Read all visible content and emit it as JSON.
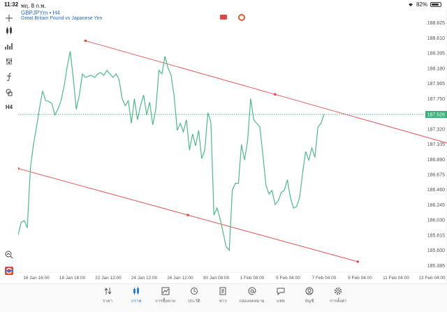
{
  "status": {
    "time": "11:32",
    "date": "พฤ. 8 ก.พ.",
    "battery": "82%",
    "battery_level": 0.82
  },
  "symbol": {
    "title": "GBPJPYm • H4",
    "description": "Great Britain Pound vs Japanese Yen"
  },
  "side_tools": {
    "timeframe": "H4"
  },
  "colors": {
    "line": "#4fb987",
    "trend": "#e24b4b",
    "price_line": "#3bb07a",
    "price_label_bg": "#3bb07a",
    "active_tab": "#2a7be4"
  },
  "chart_data": {
    "type": "line",
    "price_levels": [
      "188.825",
      "188.610",
      "188.395",
      "188.180",
      "187.965",
      "187.750",
      "187.535",
      "187.320",
      "187.105",
      "186.890",
      "186.675",
      "186.460",
      "186.245",
      "186.030",
      "185.815",
      "185.600",
      "185.385"
    ],
    "ylim": [
      185.33,
      188.91
    ],
    "time_labels": [
      "16 Jan 16:00",
      "18 Jan 16:00",
      "22 Jan 12:00",
      "24 Jan 12:00",
      "26 Jan 12:00",
      "30 Jan 08:00",
      "1 Feb 08:00",
      "5 Feb 04:00",
      "7 Feb 04:00",
      "9 Feb 04:00",
      "11 Feb 04:00",
      "13 Feb 04:00"
    ],
    "current_price": "187.526",
    "current_price_value": 187.526,
    "series": [
      {
        "values": [
          185.82,
          186.0,
          186.02,
          185.92,
          186.76,
          187.1,
          187.35,
          187.62,
          187.86,
          187.72,
          187.71,
          187.68,
          187.52,
          187.6,
          187.72,
          187.92,
          188.2,
          188.42,
          188.05,
          187.6,
          187.8,
          188.1,
          188.05,
          188.07,
          188.08,
          188.05,
          188.1,
          188.12,
          188.08,
          188.15,
          188.1,
          188.05,
          188.1,
          188.02,
          187.75,
          187.65,
          187.72,
          187.4,
          187.75,
          187.45,
          187.65,
          187.8,
          187.52,
          187.7,
          187.38,
          187.6,
          188.15,
          188.1,
          188.35,
          188.18,
          188.08,
          187.78,
          187.3,
          187.4,
          187.28,
          187.45,
          187.02,
          187.25,
          187.08,
          187.3,
          186.9,
          187.02,
          187.55,
          187.42,
          186.1,
          186.2,
          186.05,
          185.85,
          185.65,
          185.6,
          186.45,
          186.55,
          186.55,
          187.1,
          186.88,
          187.15,
          187.75,
          187.45,
          187.4,
          187.35,
          186.95,
          186.52,
          186.4,
          186.45,
          186.25,
          186.3,
          186.42,
          186.45,
          186.6,
          186.35,
          186.2,
          186.22,
          186.35,
          186.7,
          187.0,
          186.88,
          187.05,
          186.92,
          187.35,
          187.4,
          187.53
        ]
      }
    ],
    "trendlines": [
      {
        "from": {
          "index": 22,
          "value": 188.57
        },
        "to": {
          "index": 146,
          "value": 187.05
        }
      },
      {
        "from": {
          "index": 0,
          "value": 186.76
        },
        "to": {
          "index": 111,
          "value": 185.44
        }
      }
    ]
  },
  "tabs": [
    {
      "label": "ราคา",
      "icon": "quotes-icon",
      "active": false
    },
    {
      "label": "กราฟ",
      "icon": "chart-icon",
      "active": true
    },
    {
      "label": "การซื้อขาย",
      "icon": "trade-icon",
      "active": false
    },
    {
      "label": "ประวัติ",
      "icon": "history-icon",
      "active": false
    },
    {
      "label": "ข่าว",
      "icon": "news-icon",
      "active": false
    },
    {
      "label": "กล่องจดหมาย",
      "icon": "mailbox-icon",
      "active": false
    },
    {
      "label": "แชท",
      "icon": "chat-icon",
      "active": false
    },
    {
      "label": "บัญชี",
      "icon": "account-icon",
      "active": false
    },
    {
      "label": "การตั้งค่า",
      "icon": "settings-icon",
      "active": false
    }
  ]
}
